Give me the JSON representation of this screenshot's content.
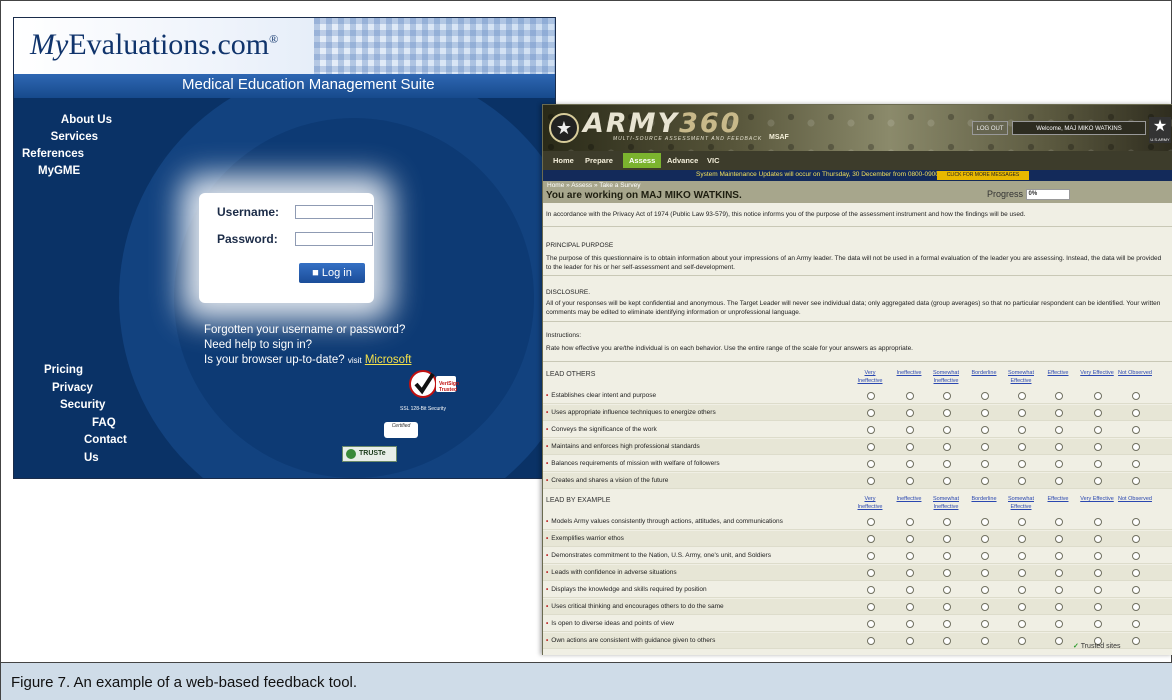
{
  "figure": {
    "caption": "Figure 7. An example of a web-based feedback tool."
  },
  "myevaluations": {
    "logo_prefix": "My",
    "logo_main": "Evaluations.com",
    "logo_reg": "®",
    "suite": "Medical Education Management Suite",
    "nav_top": [
      "About Us",
      "Services",
      "References",
      "MyGME"
    ],
    "nav_bottom": [
      "Pricing",
      "Privacy",
      "Security",
      "FAQ",
      "Contact Us"
    ],
    "username_label": "Username:",
    "password_label": "Password:",
    "login_button": "Log in",
    "help_forgot": "Forgotten your username or password?",
    "help_need": "Need help to sign in?",
    "help_browser": "Is your browser up-to-date?",
    "help_visit": "visit",
    "help_microsoft": "Microsoft",
    "verisign_label": "VeriSign Trusted",
    "ssl_label": "SSL 128-Bit Security",
    "certified_label": "Certified",
    "truste_label": "TRUSTe"
  },
  "army": {
    "logo": "ARMY",
    "logo_num": "360",
    "tagline": "MULTI-SOURCE ASSESSMENT AND FEEDBACK",
    "msaf": "MSAF",
    "logout": "LOG OUT",
    "welcome": "Welcome, MAJ MIKO WATKINS",
    "rank_label": "U.S.ARMY",
    "tabs": [
      "Home",
      "Prepare",
      "Assess",
      "Advance",
      "VIC"
    ],
    "active_tab": "Assess",
    "maintenance": "System Maintenance Updates will occur on Thursday, 30 December from 0800-0900 CST.",
    "more_messages": "CLICK FOR MORE MESSAGES",
    "breadcrumb": "Home » Assess » Take a Survey",
    "working_on": "You are working on MAJ MIKO WATKINS.",
    "progress_label": "Progress",
    "progress_value": "0%",
    "privacy_notice": "In accordance with the Privacy Act of 1974 (Public Law 93-579), this notice informs you of the purpose of the assessment instrument and how the findings will be used.",
    "principal_heading": "PRINCIPAL PURPOSE",
    "principal_text": "The purpose of this questionnaire is to obtain information about your impressions of an Army leader. The data will not be used in a formal evaluation of the leader you are assessing. Instead, the data will be provided to the leader for his or her self-assessment and self-development.",
    "disclosure_heading": "DISCLOSURE.",
    "disclosure_text": "All of your responses will be kept confidential and anonymous. The Target Leader will never see individual data; only aggregated data (group averages) so that no particular respondent can be identified. Your written comments may be edited to eliminate identifying information or unprofessional language.",
    "instructions_heading": "Instructions:",
    "instructions_text": "Rate how effective you are/the individual is on each behavior. Use the entire range of the scale for your answers as appropriate.",
    "scale": [
      "Very Ineffective",
      "Ineffective",
      "Somewhat Ineffective",
      "Borderline",
      "Somewhat Effective",
      "Effective",
      "Very Effective",
      "Not Observed"
    ],
    "sections": [
      {
        "title": "LEAD OTHERS",
        "items": [
          "Establishes clear intent and purpose",
          "Uses appropriate influence techniques to energize others",
          "Conveys the significance of the work",
          "Maintains and enforces high professional standards",
          "Balances requirements of mission with welfare of followers",
          "Creates and shares a vision of the future"
        ]
      },
      {
        "title": "LEAD BY EXAMPLE",
        "items": [
          "Models Army values consistently through actions, attitudes, and communications",
          "Exemplifies warrior ethos",
          "Demonstrates commitment to the Nation, U.S. Army, one's unit, and Soldiers",
          "Leads with confidence in adverse situations",
          "Displays the knowledge and skills required by position",
          "Uses critical thinking and encourages others to do the same",
          "Is open to diverse ideas and points of view",
          "Own actions are consistent with guidance given to others"
        ]
      }
    ],
    "trusted_sites": "Trusted sites"
  }
}
